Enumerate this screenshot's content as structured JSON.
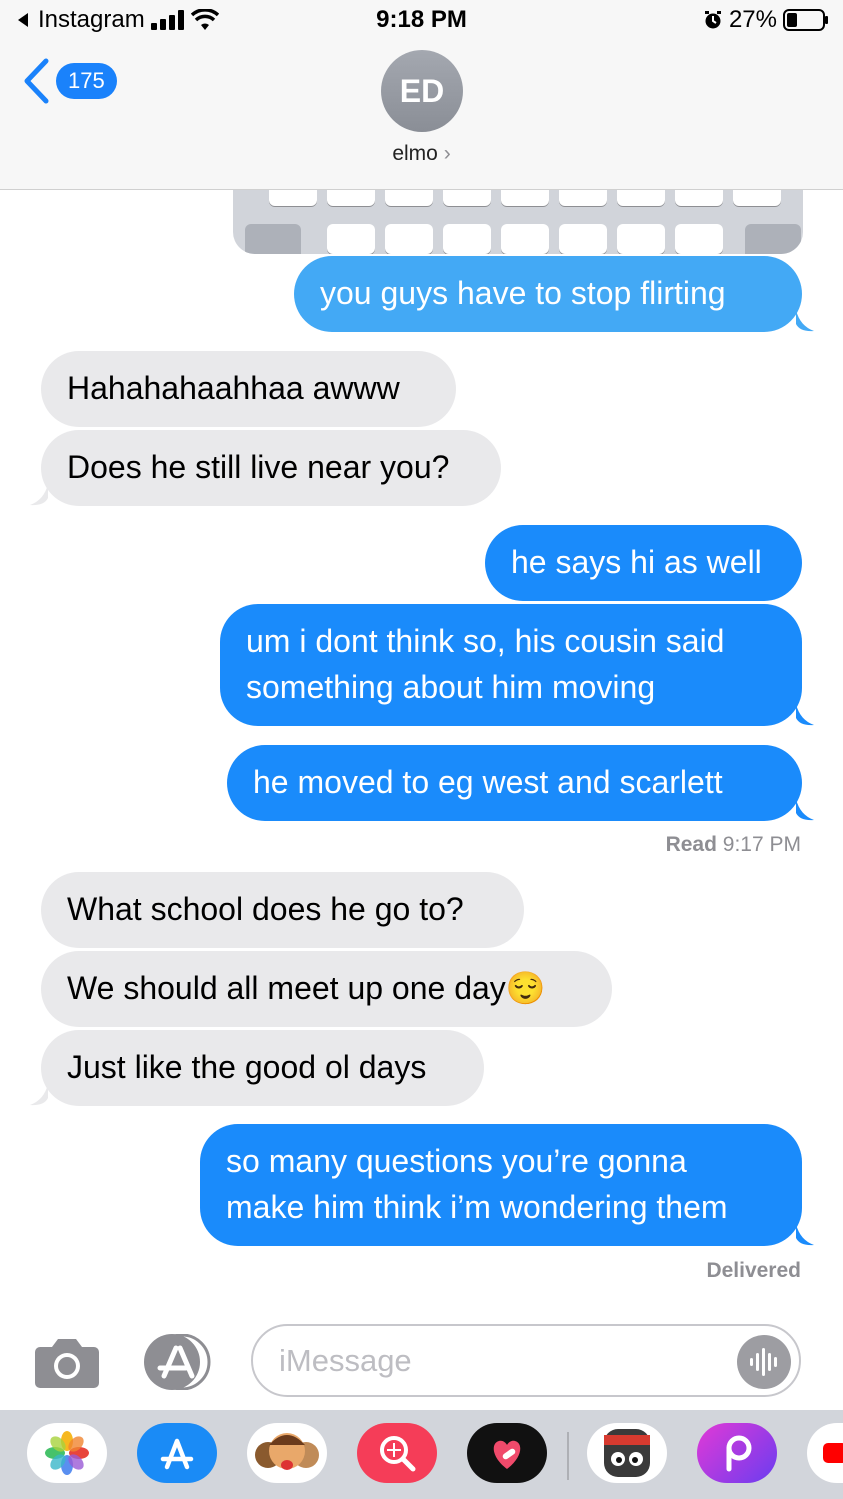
{
  "status_bar": {
    "back_app": "Instagram",
    "time": "9:18 PM",
    "battery": "27%"
  },
  "header": {
    "unread_count": "175",
    "avatar_initials": "ED",
    "contact_name": "elmo",
    "contact_chevron": "›"
  },
  "messages": [
    {
      "from": "me",
      "text": "you guys have to stop flirting"
    },
    {
      "from": "them",
      "text": "Hahahahaahhaa awww"
    },
    {
      "from": "them",
      "text": "Does he still live near you?"
    },
    {
      "from": "me",
      "text": "he says hi as well"
    },
    {
      "from": "me",
      "lines": [
        "um i dont think so, his cousin said",
        "something about him moving"
      ]
    },
    {
      "from": "me",
      "text": "he moved to eg west and scarlett"
    },
    {
      "from": "them",
      "text": "What school does he go to?"
    },
    {
      "from": "them",
      "text": "We should all meet up one day",
      "emoji": "😌"
    },
    {
      "from": "them",
      "text": "Just like the good ol days"
    },
    {
      "from": "me",
      "lines": [
        "so many questions you’re gonna",
        "make him think i’m wondering them"
      ]
    }
  ],
  "read_receipt": {
    "label": "Read",
    "time": "9:17 PM"
  },
  "delivered_label": "Delivered",
  "composer": {
    "placeholder": "iMessage"
  },
  "app_drawer": [
    "photos-app-icon",
    "app-store-icon",
    "memoji-icon",
    "search-images-icon",
    "digital-touch-icon",
    "game-app-icon",
    "picsart-icon",
    "youtube-icon"
  ],
  "colors": {
    "sent": "#1a8bfb",
    "sent_light": "#43a9f5",
    "received": "#e9e9eb",
    "badge": "#1a82fb"
  }
}
